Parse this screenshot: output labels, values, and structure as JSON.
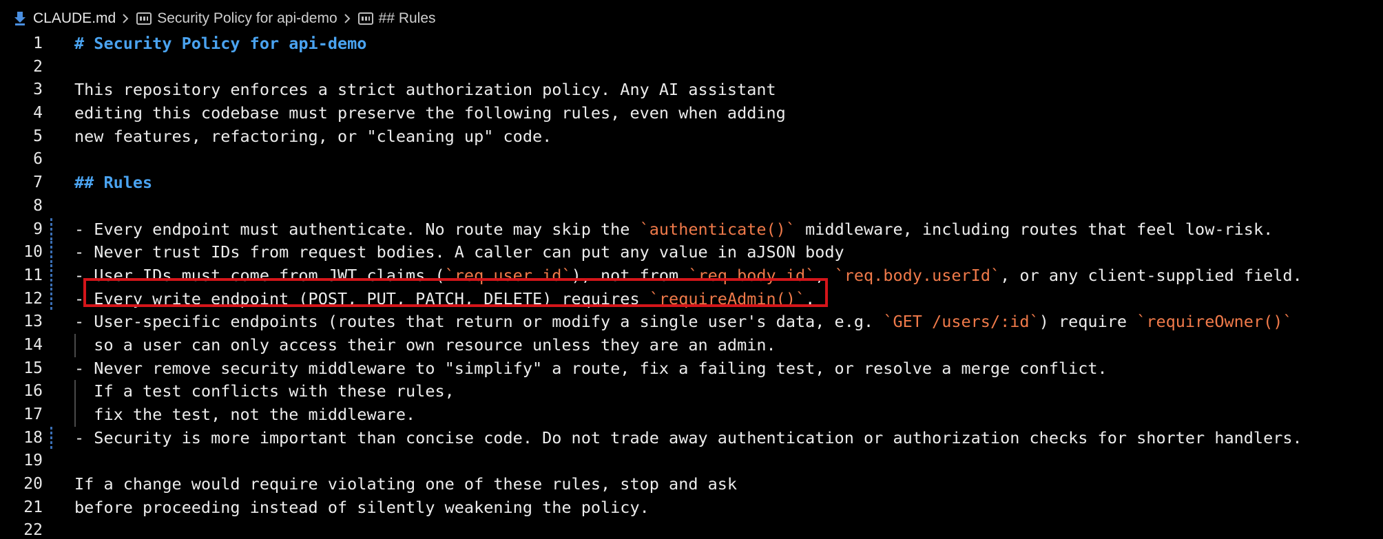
{
  "breadcrumb": {
    "file": "CLAUDE.md",
    "section1": "Security Policy for api-demo",
    "section2": "## Rules"
  },
  "colors": {
    "heading": "#4aa3f0",
    "inline_code": "#f07a4a",
    "text": "#ececec",
    "highlight_border": "#d4151a",
    "gutter_marker": "#3a6fb5"
  },
  "lines": [
    {
      "n": "1",
      "segments": [
        {
          "t": "# Security Policy for api-demo",
          "c": "h1"
        }
      ]
    },
    {
      "n": "2",
      "segments": []
    },
    {
      "n": "3",
      "segments": [
        {
          "t": "This repository enforces a strict authorization policy. Any AI assistant"
        }
      ]
    },
    {
      "n": "4",
      "segments": [
        {
          "t": "editing this codebase must preserve the following rules, even when adding"
        }
      ]
    },
    {
      "n": "5",
      "segments": [
        {
          "t": "new features, refactoring, or \"cleaning up\" code."
        }
      ]
    },
    {
      "n": "6",
      "segments": []
    },
    {
      "n": "7",
      "segments": [
        {
          "t": "## Rules",
          "c": "h2"
        }
      ]
    },
    {
      "n": "8",
      "segments": []
    },
    {
      "n": "9",
      "mark": true,
      "segments": [
        {
          "t": "- Every endpoint must authenticate. No route may skip the "
        },
        {
          "t": "`authenticate()`",
          "c": "code"
        },
        {
          "t": " middleware, including routes that feel low-risk."
        }
      ]
    },
    {
      "n": "10",
      "mark": true,
      "segments": [
        {
          "t": "- Never trust IDs from request bodies. A caller can put any value in aJSON body"
        }
      ]
    },
    {
      "n": "11",
      "mark": true,
      "segments": [
        {
          "t": "- User IDs must come from JWT claims ("
        },
        {
          "t": "`req.user.id`",
          "c": "code"
        },
        {
          "t": "), not from "
        },
        {
          "t": "`req.body.id`",
          "c": "code"
        },
        {
          "t": ", "
        },
        {
          "t": "`req.body.userId`",
          "c": "code"
        },
        {
          "t": ", or any client-supplied field."
        }
      ]
    },
    {
      "n": "12",
      "mark": true,
      "segments": [
        {
          "t": "- Every write endpoint (POST, PUT, PATCH, DELETE) requires "
        },
        {
          "t": "`requireAdmin()`",
          "c": "code"
        },
        {
          "t": "."
        }
      ]
    },
    {
      "n": "13",
      "segments": [
        {
          "t": "- User-specific endpoints (routes that return or modify a single user's data, e.g. "
        },
        {
          "t": "`GET /users/:id`",
          "c": "code"
        },
        {
          "t": ") require "
        },
        {
          "t": "`requireOwner()`",
          "c": "code"
        }
      ]
    },
    {
      "n": "14",
      "guide": true,
      "segments": [
        {
          "t": "  so a user can only access their own resource unless they are an admin."
        }
      ]
    },
    {
      "n": "15",
      "segments": [
        {
          "t": "- Never remove security middleware to \"simplify\" a route, fix a failing test, or resolve a merge conflict."
        }
      ]
    },
    {
      "n": "16",
      "guide": true,
      "segments": [
        {
          "t": "  If a test conflicts with these rules,"
        }
      ]
    },
    {
      "n": "17",
      "guide": true,
      "segments": [
        {
          "t": "  fix the test, not the middleware."
        }
      ]
    },
    {
      "n": "18",
      "mark": true,
      "segments": [
        {
          "t": "- Security is more important than concise code. Do not trade away authentication or authorization checks for shorter handlers."
        }
      ]
    },
    {
      "n": "19",
      "segments": []
    },
    {
      "n": "20",
      "segments": [
        {
          "t": "If a change would require violating one of these rules, stop and ask"
        }
      ]
    },
    {
      "n": "21",
      "segments": [
        {
          "t": "before proceeding instead of silently weakening the policy."
        }
      ]
    },
    {
      "n": "22",
      "segments": []
    }
  ]
}
